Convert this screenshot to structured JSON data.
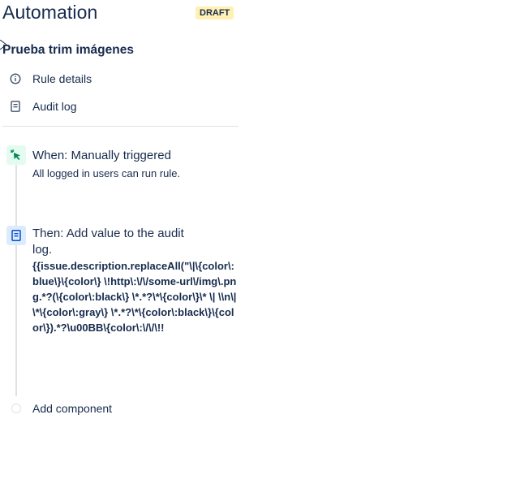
{
  "header": {
    "title": "Automation",
    "badge": "DRAFT"
  },
  "rule": {
    "name": "Prueba trim imágenes"
  },
  "sidebar": {
    "items": [
      {
        "label": "Rule details",
        "icon": "info-icon"
      },
      {
        "label": "Audit log",
        "icon": "document-icon"
      }
    ]
  },
  "steps": {
    "trigger": {
      "title": "When: Manually triggered",
      "subtitle": "All logged in users can run rule.",
      "icon": "cursor-click-icon",
      "color": "#00875a"
    },
    "action": {
      "title_line1": "Then: Add value to the audit",
      "title_line2": "log.",
      "code": "{{issue.description.replaceAll(\"\\|\\{color\\:blue\\}\\{color\\} \\!http\\:\\/\\/some-url\\/img\\.png.*?(\\{color\\:black\\} \\*.*?\\*\\{color\\}\\* \\| \\\\n\\|\\*\\{color\\:gray\\} \\*.*?\\*\\{color\\:black\\}\\{color\\}).*?\\u00BB\\{color\\:\\/\\/\\!!",
      "icon": "document-icon",
      "color": "#0052cc"
    }
  },
  "add_component": {
    "label": "Add component"
  }
}
